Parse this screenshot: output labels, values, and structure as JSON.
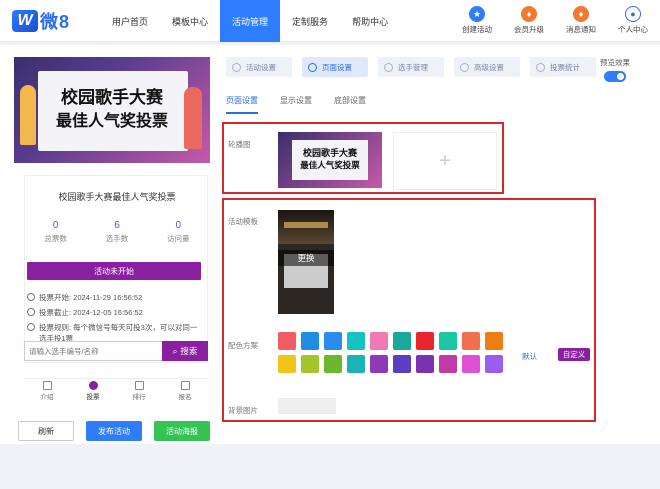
{
  "logo": {
    "mark": "W",
    "text": "微8"
  },
  "nav": [
    {
      "label": "用户首页"
    },
    {
      "label": "模板中心"
    },
    {
      "label": "活动管理"
    },
    {
      "label": "定制服务"
    },
    {
      "label": "帮助中心"
    }
  ],
  "tools": [
    {
      "label": "创建活动",
      "icon": "star-icon",
      "color": "#2e7dff"
    },
    {
      "label": "会员升级",
      "icon": "vip-icon",
      "color": "#f07a2f"
    },
    {
      "label": "消息通知",
      "icon": "bell-icon",
      "color": "#f07a2f"
    },
    {
      "label": "个人中心",
      "icon": "user-icon",
      "color": "#2e6de0"
    }
  ],
  "preview": {
    "banner_line1": "校园歌手大赛",
    "banner_line2": "最佳人气奖投票",
    "title": "校园歌手大赛最佳人气奖投票",
    "stats": [
      {
        "value": "0",
        "label": "总票数"
      },
      {
        "value": "6",
        "label": "选手数"
      },
      {
        "value": "0",
        "label": "访问量"
      }
    ],
    "status": "活动未开始",
    "rules": [
      {
        "text": "投票开始:  2024-11-29 16:56:52"
      },
      {
        "text": "投票截止:  2024-12-05 16:56:52"
      },
      {
        "text": "投票规则:  每个微信号每天可投3次，可以对同一选手投1票"
      }
    ],
    "search_placeholder": "请输入选手编号/名称",
    "search_button": "搜索",
    "bottom_nav": [
      {
        "label": "介绍"
      },
      {
        "label": "投票"
      },
      {
        "label": "排行"
      },
      {
        "label": "报名"
      }
    ],
    "actions": {
      "refresh": "刷新",
      "publish": "发布活动",
      "poster": "活动海报"
    }
  },
  "steps": [
    {
      "label": "活动设置"
    },
    {
      "label": "页面设置"
    },
    {
      "label": "选手管理"
    },
    {
      "label": "高级设置"
    },
    {
      "label": "投票统计"
    }
  ],
  "preview_toggle": {
    "label": "预览效果",
    "on": true
  },
  "subtabs": [
    {
      "label": "页面设置"
    },
    {
      "label": "显示设置"
    },
    {
      "label": "底部设置"
    }
  ],
  "carousel": {
    "label": "轮播图",
    "thumb_line1": "校园歌手大赛",
    "thumb_line2": "最佳人气奖投票",
    "add": "+"
  },
  "template": {
    "label": "活动模板",
    "swap": "更换"
  },
  "colors": {
    "label": "配色方案",
    "swatches": [
      "#f25d63",
      "#1f8ce6",
      "#2a8cf0",
      "#13c2c2",
      "#f07ab4",
      "#1aa89a",
      "#e6262b",
      "#1dc6a4",
      "#f26f4d",
      "#ef7d16",
      "#f0c419",
      "#a3c52a",
      "#6bb82c",
      "#18b4b7",
      "#8e3ab8",
      "#5b3fc0",
      "#7a32b0",
      "#c23aa8",
      "#e04fd8",
      "#9a5df0"
    ],
    "default": "默认",
    "custom": "自定义"
  },
  "background": {
    "label": "背景图片"
  }
}
